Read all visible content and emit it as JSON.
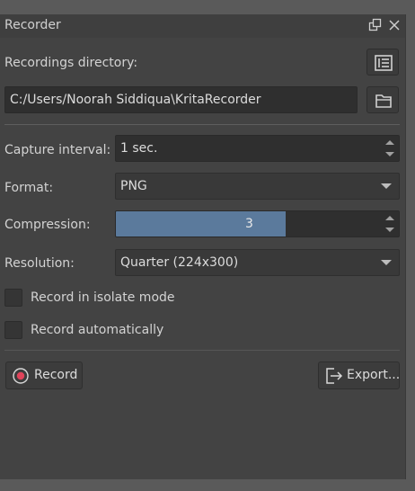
{
  "panel": {
    "title": "Recorder",
    "float_icon": "float-window-icon",
    "close_icon": "close-icon"
  },
  "directory": {
    "label": "Recordings directory:",
    "manage_icon": "manage-recordings-icon",
    "path": "C:/Users/Noorah Siddiqua\\KritaRecorder",
    "browse_icon": "folder-icon"
  },
  "capture_interval": {
    "label": "Capture interval:",
    "value": "1 sec."
  },
  "format": {
    "label": "Format:",
    "value": "PNG"
  },
  "compression": {
    "label": "Compression:",
    "value": "3",
    "fill_fraction": 0.6
  },
  "resolution": {
    "label": "Resolution:",
    "value": "Quarter (224x300)"
  },
  "options": {
    "isolate_label": "Record in isolate mode",
    "isolate_checked": false,
    "auto_label": "Record automatically",
    "auto_checked": false
  },
  "actions": {
    "record_label": "Record",
    "record_icon": "record-icon",
    "export_label": "Export...",
    "export_icon": "export-icon"
  },
  "colors": {
    "panel_bg": "#434343",
    "slider_fill": "#5b7a9c",
    "record_dot": "#e0435a"
  }
}
